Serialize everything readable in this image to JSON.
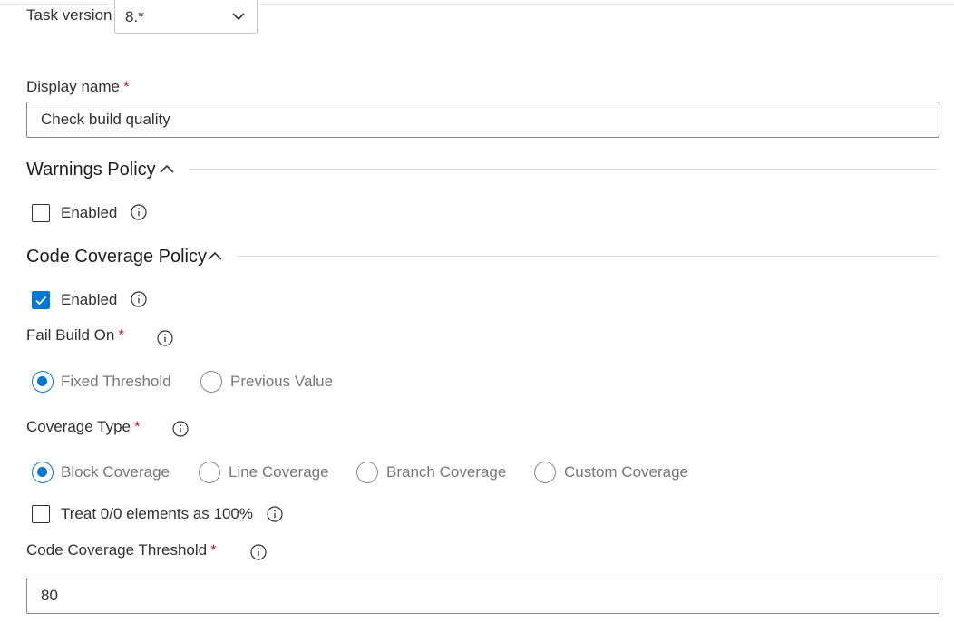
{
  "task_version": {
    "label": "Task version",
    "value": "8.*"
  },
  "display_name": {
    "label": "Display name",
    "required": "*",
    "value": "Check build quality"
  },
  "warnings_policy": {
    "title": "Warnings Policy",
    "enabled_label": "Enabled",
    "enabled": false
  },
  "code_coverage_policy": {
    "title": "Code Coverage Policy",
    "enabled_label": "Enabled",
    "enabled": true,
    "fail_build_on": {
      "label": "Fail Build On",
      "required": "*",
      "options": [
        "Fixed Threshold",
        "Previous Value"
      ],
      "selected": "Fixed Threshold"
    },
    "coverage_type": {
      "label": "Coverage Type",
      "required": "*",
      "options": [
        "Block Coverage",
        "Line Coverage",
        "Branch Coverage",
        "Custom Coverage"
      ],
      "selected": "Block Coverage"
    },
    "treat_zero_label": "Treat 0/0 elements as 100%",
    "treat_zero": false,
    "threshold": {
      "label": "Code Coverage Threshold",
      "required": "*",
      "value": "80"
    }
  },
  "colors": {
    "accent": "#0078d4",
    "required": "#a4262c",
    "text": "#323130",
    "muted": "#797775"
  },
  "icons": [
    "chevron-down-icon",
    "chevron-up-icon",
    "info-icon",
    "checkmark-icon"
  ]
}
